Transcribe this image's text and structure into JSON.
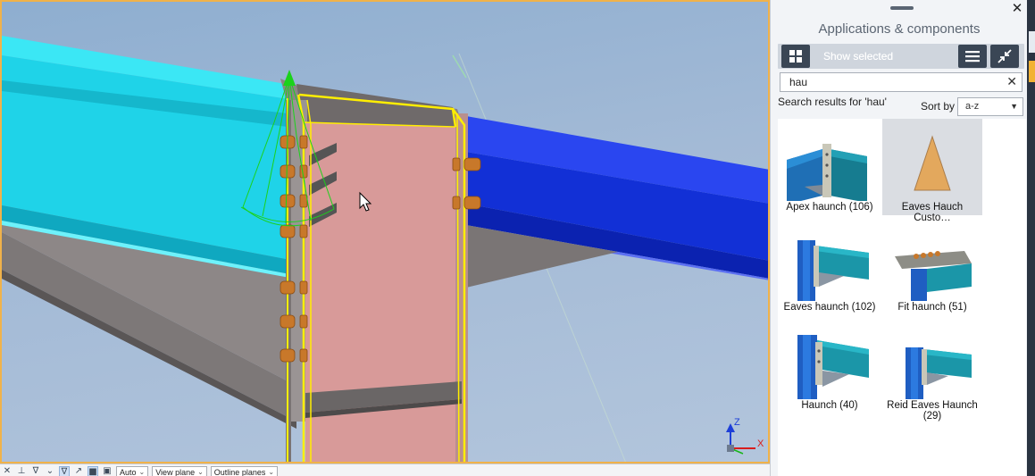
{
  "panel": {
    "title": "Applications & components",
    "close_label": "✕",
    "show_selected_label": "Show selected",
    "search": {
      "value": "hau",
      "clear_label": "✕"
    },
    "results_label": "Search results for 'hau'",
    "sort": {
      "label": "Sort by",
      "selected": "a-z"
    },
    "results": [
      {
        "label": "Apex haunch (106)",
        "icon": "apex-haunch-thumbnail"
      },
      {
        "label": "Eaves Hauch Custo…",
        "icon": "custom-triangle-thumbnail",
        "selected": true
      },
      {
        "label": "Eaves haunch (102)",
        "icon": "eaves-haunch-thumbnail"
      },
      {
        "label": "Fit haunch (51)",
        "icon": "fit-haunch-thumbnail"
      },
      {
        "label": "Haunch (40)",
        "icon": "haunch-thumbnail"
      },
      {
        "label": "Reid Eaves Haunch (29)",
        "icon": "reid-eaves-haunch-thumbnail"
      }
    ]
  },
  "toolbar": {
    "dropdowns": [
      {
        "value": "Auto"
      },
      {
        "value": "View plane"
      },
      {
        "value": "Outline planes"
      }
    ]
  },
  "viewport": {
    "axis_labels": {
      "z": "Z",
      "x": "X"
    }
  },
  "colors": {
    "accent_border": "#f0b24a",
    "panel_dark": "#3a4655",
    "beam_cyan": "#1fd3e8",
    "beam_blue": "#1230d6",
    "plate_pink": "#d89a99",
    "bolt_orange": "#c8782a",
    "highlight_yellow": "#ffee00"
  }
}
